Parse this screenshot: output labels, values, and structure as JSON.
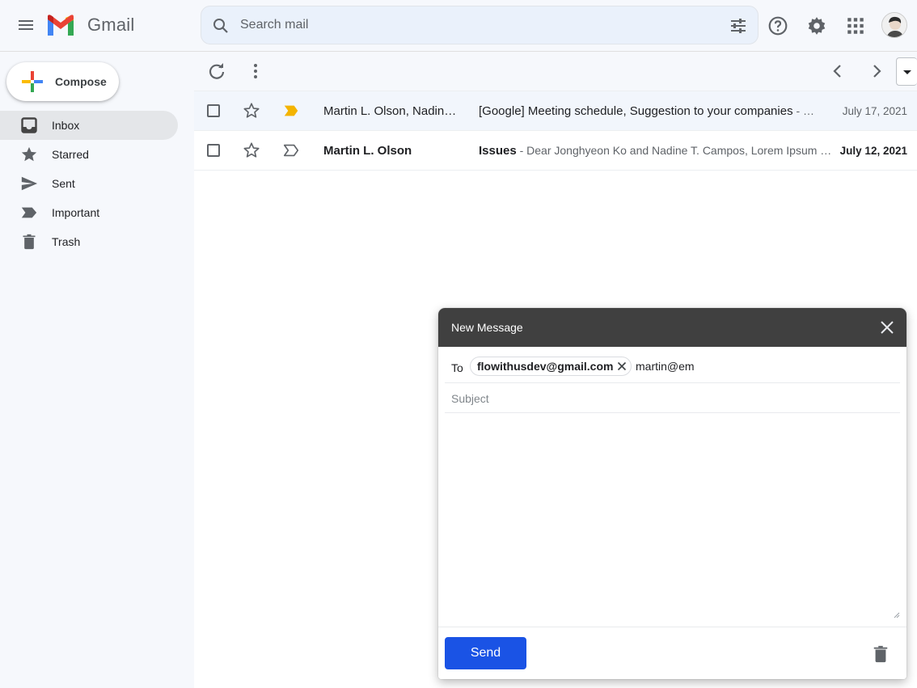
{
  "header": {
    "app_name": "Gmail",
    "search_placeholder": "Search mail"
  },
  "sidebar": {
    "compose_label": "Compose",
    "items": [
      {
        "label": "Inbox",
        "icon": "inbox-icon",
        "active": true
      },
      {
        "label": "Starred",
        "icon": "star-icon",
        "active": false
      },
      {
        "label": "Sent",
        "icon": "send-icon",
        "active": false
      },
      {
        "label": "Important",
        "icon": "important-icon",
        "active": false
      },
      {
        "label": "Trash",
        "icon": "trash-icon",
        "active": false
      }
    ]
  },
  "emails": [
    {
      "sender": "Martin L. Olson, Nadin…",
      "subject": "[Google] Meeting schedule, Suggestion to your companies",
      "snippet": " - …",
      "date": "July 17, 2021",
      "important": true,
      "read": true
    },
    {
      "sender": "Martin L. Olson",
      "subject": "Issues",
      "snippet": " - Dear Jonghyeon Ko and Nadine T. Campos, Lorem Ipsum …",
      "date": "July 12, 2021",
      "important": false,
      "read": false
    }
  ],
  "compose_window": {
    "title": "New Message",
    "to_label": "To",
    "recipient_chip": "flowithusdev@gmail.com",
    "to_value": "martin@em",
    "subject_placeholder": "Subject",
    "send_label": "Send"
  },
  "colors": {
    "send_button": "#1a53e5",
    "compose_header": "#404040",
    "important_marker": "#f4b400",
    "background": "#f6f8fc"
  }
}
